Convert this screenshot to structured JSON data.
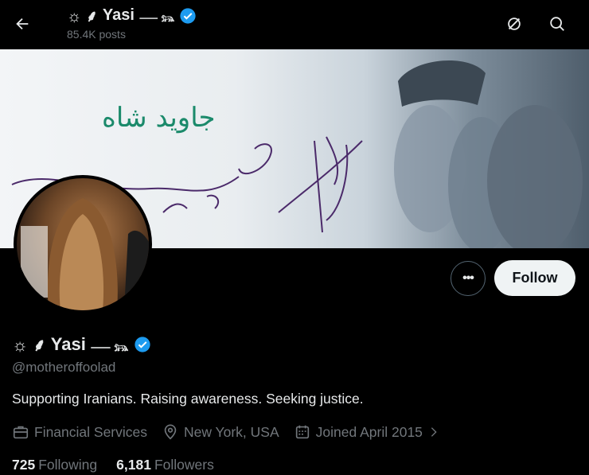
{
  "header": {
    "name_prefix": "☼ ⸙",
    "name": "Yasi",
    "name_suffix": "⸺ 𓃬",
    "posts_count": "85.4K posts"
  },
  "banner": {
    "text": "جاوید شاه"
  },
  "profile": {
    "name_prefix": "☼ ⸙",
    "name": "Yasi",
    "name_suffix": "⸺ 𓃬",
    "handle": "@motheroffoolad",
    "bio": "Supporting Iranians. Raising awareness. Seeking justice.",
    "category": "Financial Services",
    "location": "New York, USA",
    "joined": "Joined April 2015",
    "following_count": "725",
    "following_label": "Following",
    "followers_count": "6,181",
    "followers_label": "Followers"
  },
  "actions": {
    "more_label": "•••",
    "follow_label": "Follow"
  },
  "colors": {
    "verified": "#1d9bf0",
    "background": "#000000",
    "secondary_text": "#71767b"
  }
}
